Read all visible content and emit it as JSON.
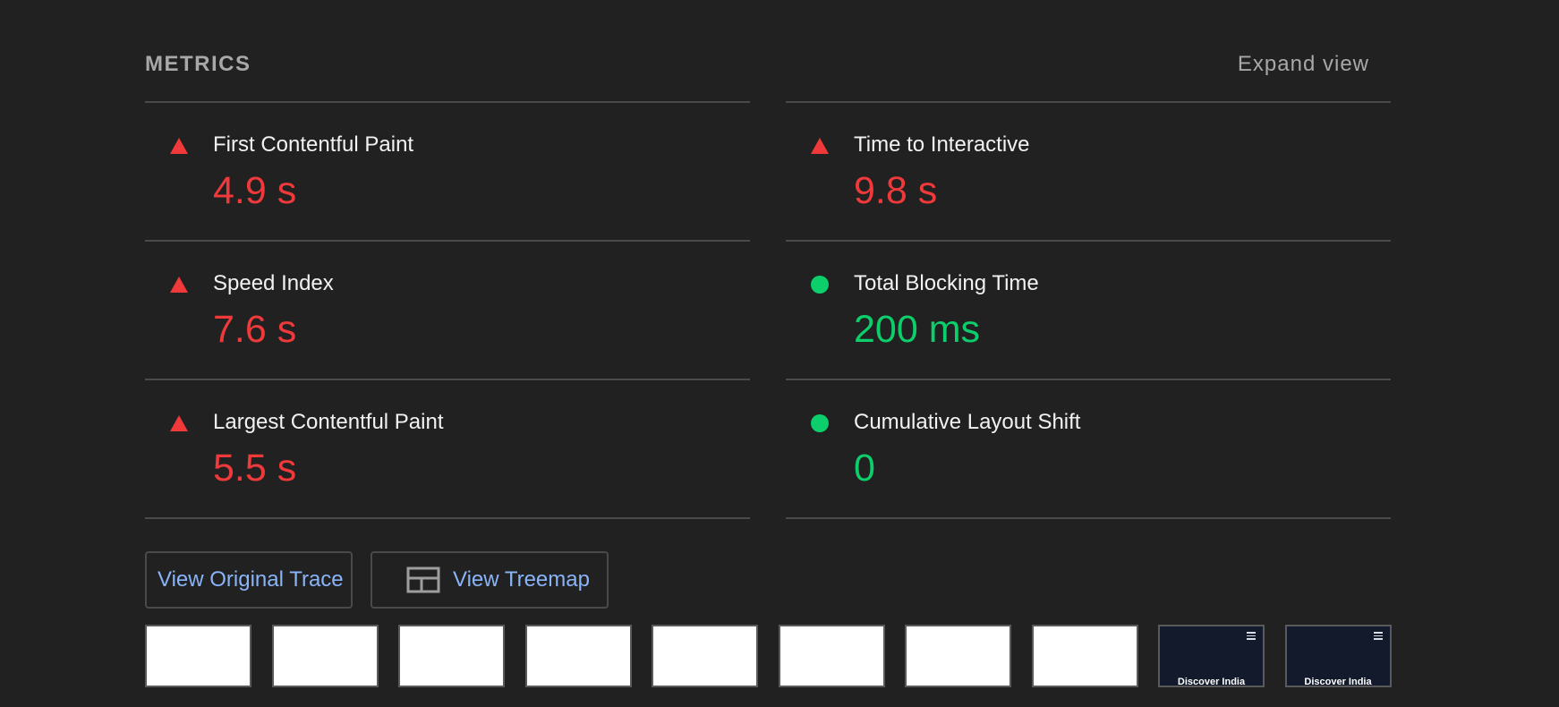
{
  "header": {
    "title": "METRICS",
    "expand_label": "Expand view"
  },
  "colors": {
    "fail": "#f0393a",
    "pass": "#0cce6b",
    "link": "#8ab4f8"
  },
  "metrics": {
    "left": [
      {
        "label": "First Contentful Paint",
        "value": "4.9 s",
        "status": "fail",
        "icon": "triangle-warning-icon"
      },
      {
        "label": "Speed Index",
        "value": "7.6 s",
        "status": "fail",
        "icon": "triangle-warning-icon"
      },
      {
        "label": "Largest Contentful Paint",
        "value": "5.5 s",
        "status": "fail",
        "icon": "triangle-warning-icon"
      }
    ],
    "right": [
      {
        "label": "Time to Interactive",
        "value": "9.8 s",
        "status": "fail",
        "icon": "triangle-warning-icon"
      },
      {
        "label": "Total Blocking Time",
        "value": "200 ms",
        "status": "pass",
        "icon": "circle-pass-icon"
      },
      {
        "label": "Cumulative Layout Shift",
        "value": "0",
        "status": "pass",
        "icon": "circle-pass-icon"
      }
    ]
  },
  "buttons": {
    "trace_label": "View Original Trace",
    "treemap_label": "View Treemap",
    "treemap_icon": "treemap-icon"
  },
  "filmstrip": {
    "frames": [
      {
        "style": "white",
        "text": ""
      },
      {
        "style": "white",
        "text": ""
      },
      {
        "style": "white",
        "text": ""
      },
      {
        "style": "white",
        "text": ""
      },
      {
        "style": "white",
        "text": ""
      },
      {
        "style": "white",
        "text": ""
      },
      {
        "style": "white",
        "text": ""
      },
      {
        "style": "white",
        "text": ""
      },
      {
        "style": "dark",
        "text": "Discover India"
      },
      {
        "style": "dark",
        "text": "Discover India"
      }
    ]
  }
}
